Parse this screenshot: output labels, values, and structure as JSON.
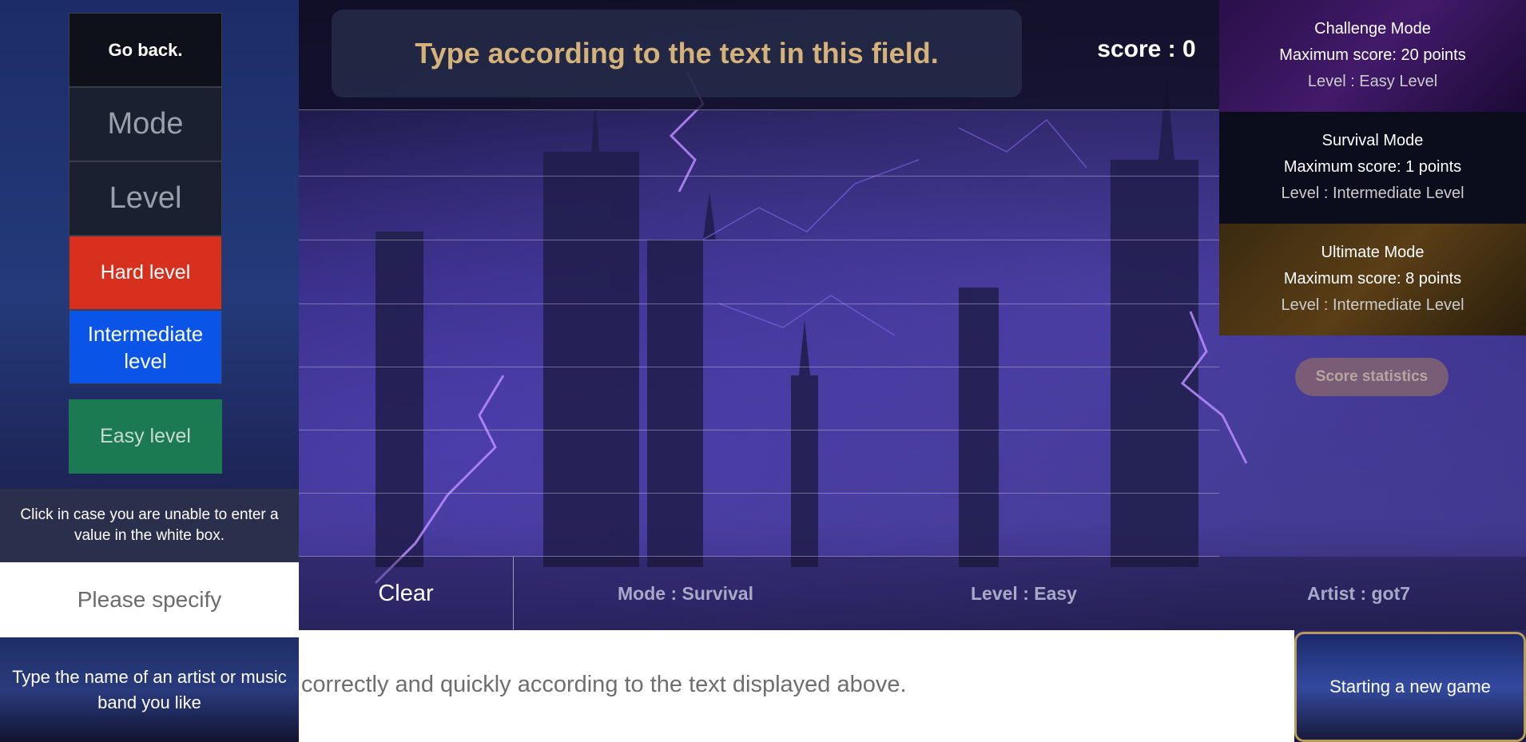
{
  "left_panel": {
    "back_label": "Go back.",
    "mode_label": "Mode",
    "level_label": "Level",
    "hard_label": "Hard level",
    "intermediate_label": "Intermediate level",
    "easy_label": "Easy level",
    "help_note": "Click in case you are unable to enter a value in the white box.",
    "specify_label": "Please specify",
    "artist_hint": "Type the name of an artist or music band you like"
  },
  "top_bar": {
    "prompt": "Type according to the text in this field.",
    "score": "score : 0"
  },
  "mode_cards": [
    {
      "title": "Challenge Mode",
      "max_score": "Maximum score: 20 points",
      "level": "Level : Easy Level"
    },
    {
      "title": "Survival Mode",
      "max_score": "Maximum score: 1 points",
      "level": "Level : Intermediate Level"
    },
    {
      "title": "Ultimate Mode",
      "max_score": "Maximum score: 8 points",
      "level": "Level : Intermediate Level"
    }
  ],
  "stats_label": "Score statistics",
  "status_bar": {
    "clear_label": "Clear",
    "mode": "Mode : Survival",
    "level": "Level : Easy",
    "artist": "Artist : got7"
  },
  "input": {
    "text": "Type correctly and quickly according to the text displayed above."
  },
  "new_game_label": "Starting a new game",
  "colors": {
    "hard": "#d7301f",
    "intermediate": "#0a55e8",
    "easy": "#1b7a52",
    "prompt_text": "#d4b27a"
  }
}
